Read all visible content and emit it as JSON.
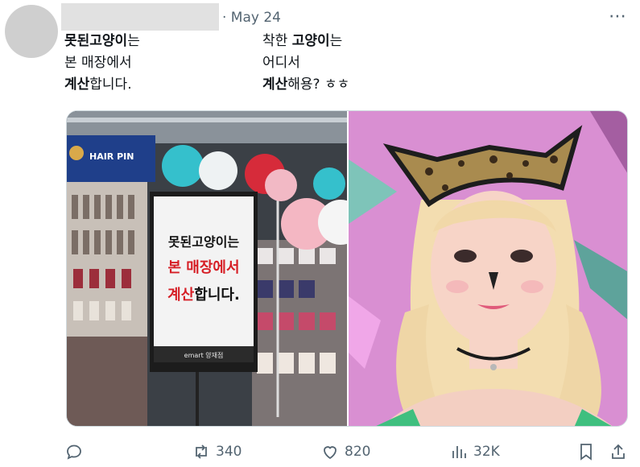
{
  "header": {
    "date": "· May 24",
    "more_label": "⋯"
  },
  "tweet": {
    "left": {
      "line1_bold": "못된고양이",
      "line1_rest": "는",
      "line2": "본 매장에서",
      "line3_bold": "계산",
      "line3_rest": "합니다."
    },
    "right": {
      "line1_pre": "착한 ",
      "line1_bold": "고양이",
      "line1_rest": "는",
      "line2": "어디서",
      "line3_bold": "계산",
      "line3_rest": "해용? ㅎㅎ"
    }
  },
  "media": {
    "sign": {
      "line1": "못된고양이는",
      "line2": "본 매장에서",
      "line3_red": "계산",
      "line3_rest": "합니다.",
      "footer": "emart 양재점"
    },
    "store_banner": "HAIR PIN"
  },
  "actions": {
    "reply_count": "",
    "retweet_count": "340",
    "like_count": "820",
    "views_count": "32K"
  },
  "colors": {
    "text": "#0f1419",
    "muted": "#536471",
    "sign_red": "#d61f26",
    "idol_bg": "#d58fcf"
  }
}
